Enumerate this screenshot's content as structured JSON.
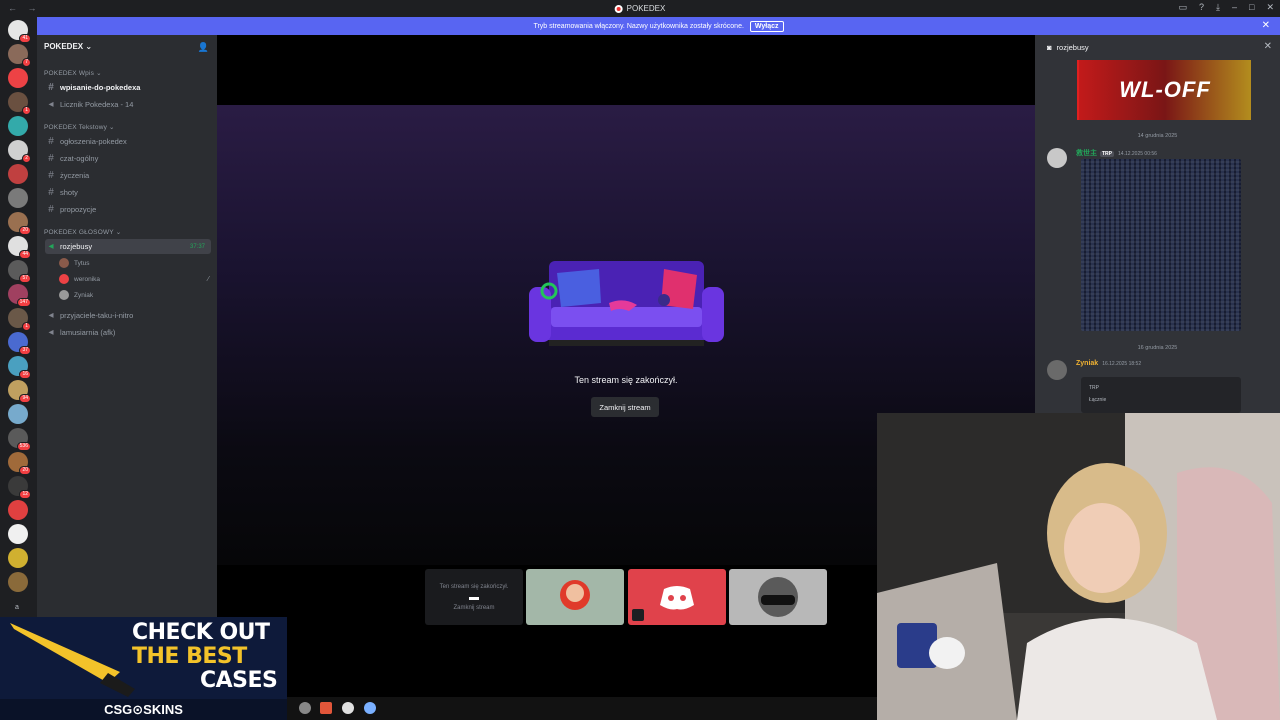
{
  "window": {
    "title": "POKEDEX"
  },
  "banner": {
    "text": "Tryb streamowania włączony. Nazwy użytkownika zostały skrócone.",
    "button": "Wyłącz"
  },
  "rail": {
    "servers": [
      {
        "color": "#e6e6e6",
        "badge": "41"
      },
      {
        "color": "#8a6a5a",
        "badge": "7"
      },
      {
        "color": "#ed4245",
        "badge": ""
      },
      {
        "color": "#6a5040",
        "badge": "1"
      },
      {
        "color": "#3aa",
        "badge": ""
      },
      {
        "color": "#d0d0d0",
        "badge": "2"
      },
      {
        "color": "#c04040",
        "badge": ""
      },
      {
        "color": "#7a7a7a",
        "badge": ""
      },
      {
        "color": "#9a7050",
        "badge": "20"
      },
      {
        "color": "#e0e0e0",
        "badge": "44"
      },
      {
        "color": "#5b5b5b",
        "badge": "57"
      },
      {
        "color": "#a04060",
        "badge": "147"
      },
      {
        "color": "#6a5848",
        "badge": "1"
      },
      {
        "color": "#4a6ad0",
        "badge": "37"
      },
      {
        "color": "#4aa0c0",
        "badge": "16"
      },
      {
        "color": "#c0a060",
        "badge": "94"
      },
      {
        "color": "#7ac",
        "badge": ""
      },
      {
        "color": "#5a5a5a",
        "badge": "536"
      },
      {
        "color": "#a06a3a",
        "badge": "20"
      },
      {
        "color": "#3a3a3a",
        "badge": "12"
      },
      {
        "color": "#e04040",
        "badge": ""
      },
      {
        "color": "#f0f0f0",
        "badge": ""
      },
      {
        "color": "#d0b030",
        "badge": ""
      },
      {
        "color": "#8a6a3a",
        "badge": ""
      }
    ],
    "bottom_letter": "a"
  },
  "sidebar": {
    "guild": "POKEDEX",
    "categories": {
      "wpis": "POKEDEX Wpis",
      "tekstowy": "POKEDEX Tekstowy",
      "glosowy": "POKEDEX GŁOSOWY"
    },
    "channels": {
      "wpisanie": "wpisanie-do-pokedexa",
      "licznik": "Licznik Pokedexa - 14",
      "ogloszenia": "ogłoszenia-pokedex",
      "czat": "czat-ogólny",
      "zyczenia": "życzenia",
      "shoty": "shoty",
      "propozycje": "propozycje",
      "rozjebusy": "rozjebusy",
      "rozjebusy_time": "37:37",
      "przyjaciele": "przyjaciele-taku-i-nitro",
      "lamusiarnia": "lamusiarnia (afk)"
    },
    "members": [
      "Tytus",
      "weronika",
      "Zyniak"
    ]
  },
  "stream": {
    "ended": "Ten stream się zakończył.",
    "close": "Zamknij stream",
    "tile_ended": "Ten stream się zakończył.",
    "tile_close": "Zamknij stream"
  },
  "chat": {
    "channel": "rozjebusy",
    "image_text": "WL-OFF",
    "date1": "14 grudnia 2025",
    "msg1_name": "救世主",
    "msg1_tag": "TRP",
    "msg1_time": "14.12.2025 00:56",
    "date2": "16 grudnia 2025",
    "msg2_name": "Zyniak",
    "msg2_time": "16.12.2025 18:52",
    "embed_tag": "TRP",
    "embed_sub": "Łącznie"
  },
  "ad": {
    "line1": "CHECK OUT",
    "line2": "THE BEST",
    "line3": "CASES",
    "brand": "CSG⊙SKINS"
  }
}
